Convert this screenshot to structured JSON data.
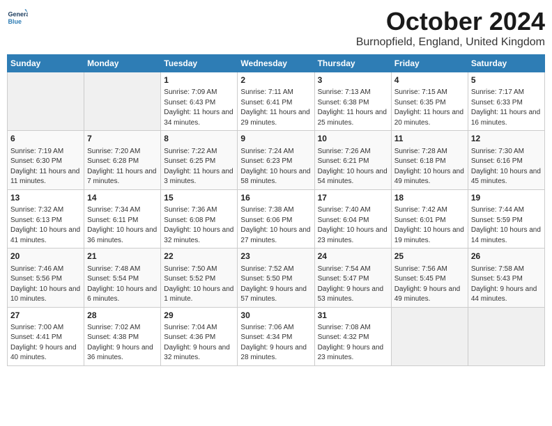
{
  "header": {
    "logo_line1": "General",
    "logo_line2": "Blue",
    "month": "October 2024",
    "location": "Burnopfield, England, United Kingdom"
  },
  "weekdays": [
    "Sunday",
    "Monday",
    "Tuesday",
    "Wednesday",
    "Thursday",
    "Friday",
    "Saturday"
  ],
  "weeks": [
    [
      {
        "day": "",
        "sunrise": "",
        "sunset": "",
        "daylight": ""
      },
      {
        "day": "",
        "sunrise": "",
        "sunset": "",
        "daylight": ""
      },
      {
        "day": "1",
        "sunrise": "Sunrise: 7:09 AM",
        "sunset": "Sunset: 6:43 PM",
        "daylight": "Daylight: 11 hours and 34 minutes."
      },
      {
        "day": "2",
        "sunrise": "Sunrise: 7:11 AM",
        "sunset": "Sunset: 6:41 PM",
        "daylight": "Daylight: 11 hours and 29 minutes."
      },
      {
        "day": "3",
        "sunrise": "Sunrise: 7:13 AM",
        "sunset": "Sunset: 6:38 PM",
        "daylight": "Daylight: 11 hours and 25 minutes."
      },
      {
        "day": "4",
        "sunrise": "Sunrise: 7:15 AM",
        "sunset": "Sunset: 6:35 PM",
        "daylight": "Daylight: 11 hours and 20 minutes."
      },
      {
        "day": "5",
        "sunrise": "Sunrise: 7:17 AM",
        "sunset": "Sunset: 6:33 PM",
        "daylight": "Daylight: 11 hours and 16 minutes."
      }
    ],
    [
      {
        "day": "6",
        "sunrise": "Sunrise: 7:19 AM",
        "sunset": "Sunset: 6:30 PM",
        "daylight": "Daylight: 11 hours and 11 minutes."
      },
      {
        "day": "7",
        "sunrise": "Sunrise: 7:20 AM",
        "sunset": "Sunset: 6:28 PM",
        "daylight": "Daylight: 11 hours and 7 minutes."
      },
      {
        "day": "8",
        "sunrise": "Sunrise: 7:22 AM",
        "sunset": "Sunset: 6:25 PM",
        "daylight": "Daylight: 11 hours and 3 minutes."
      },
      {
        "day": "9",
        "sunrise": "Sunrise: 7:24 AM",
        "sunset": "Sunset: 6:23 PM",
        "daylight": "Daylight: 10 hours and 58 minutes."
      },
      {
        "day": "10",
        "sunrise": "Sunrise: 7:26 AM",
        "sunset": "Sunset: 6:21 PM",
        "daylight": "Daylight: 10 hours and 54 minutes."
      },
      {
        "day": "11",
        "sunrise": "Sunrise: 7:28 AM",
        "sunset": "Sunset: 6:18 PM",
        "daylight": "Daylight: 10 hours and 49 minutes."
      },
      {
        "day": "12",
        "sunrise": "Sunrise: 7:30 AM",
        "sunset": "Sunset: 6:16 PM",
        "daylight": "Daylight: 10 hours and 45 minutes."
      }
    ],
    [
      {
        "day": "13",
        "sunrise": "Sunrise: 7:32 AM",
        "sunset": "Sunset: 6:13 PM",
        "daylight": "Daylight: 10 hours and 41 minutes."
      },
      {
        "day": "14",
        "sunrise": "Sunrise: 7:34 AM",
        "sunset": "Sunset: 6:11 PM",
        "daylight": "Daylight: 10 hours and 36 minutes."
      },
      {
        "day": "15",
        "sunrise": "Sunrise: 7:36 AM",
        "sunset": "Sunset: 6:08 PM",
        "daylight": "Daylight: 10 hours and 32 minutes."
      },
      {
        "day": "16",
        "sunrise": "Sunrise: 7:38 AM",
        "sunset": "Sunset: 6:06 PM",
        "daylight": "Daylight: 10 hours and 27 minutes."
      },
      {
        "day": "17",
        "sunrise": "Sunrise: 7:40 AM",
        "sunset": "Sunset: 6:04 PM",
        "daylight": "Daylight: 10 hours and 23 minutes."
      },
      {
        "day": "18",
        "sunrise": "Sunrise: 7:42 AM",
        "sunset": "Sunset: 6:01 PM",
        "daylight": "Daylight: 10 hours and 19 minutes."
      },
      {
        "day": "19",
        "sunrise": "Sunrise: 7:44 AM",
        "sunset": "Sunset: 5:59 PM",
        "daylight": "Daylight: 10 hours and 14 minutes."
      }
    ],
    [
      {
        "day": "20",
        "sunrise": "Sunrise: 7:46 AM",
        "sunset": "Sunset: 5:56 PM",
        "daylight": "Daylight: 10 hours and 10 minutes."
      },
      {
        "day": "21",
        "sunrise": "Sunrise: 7:48 AM",
        "sunset": "Sunset: 5:54 PM",
        "daylight": "Daylight: 10 hours and 6 minutes."
      },
      {
        "day": "22",
        "sunrise": "Sunrise: 7:50 AM",
        "sunset": "Sunset: 5:52 PM",
        "daylight": "Daylight: 10 hours and 1 minute."
      },
      {
        "day": "23",
        "sunrise": "Sunrise: 7:52 AM",
        "sunset": "Sunset: 5:50 PM",
        "daylight": "Daylight: 9 hours and 57 minutes."
      },
      {
        "day": "24",
        "sunrise": "Sunrise: 7:54 AM",
        "sunset": "Sunset: 5:47 PM",
        "daylight": "Daylight: 9 hours and 53 minutes."
      },
      {
        "day": "25",
        "sunrise": "Sunrise: 7:56 AM",
        "sunset": "Sunset: 5:45 PM",
        "daylight": "Daylight: 9 hours and 49 minutes."
      },
      {
        "day": "26",
        "sunrise": "Sunrise: 7:58 AM",
        "sunset": "Sunset: 5:43 PM",
        "daylight": "Daylight: 9 hours and 44 minutes."
      }
    ],
    [
      {
        "day": "27",
        "sunrise": "Sunrise: 7:00 AM",
        "sunset": "Sunset: 4:41 PM",
        "daylight": "Daylight: 9 hours and 40 minutes."
      },
      {
        "day": "28",
        "sunrise": "Sunrise: 7:02 AM",
        "sunset": "Sunset: 4:38 PM",
        "daylight": "Daylight: 9 hours and 36 minutes."
      },
      {
        "day": "29",
        "sunrise": "Sunrise: 7:04 AM",
        "sunset": "Sunset: 4:36 PM",
        "daylight": "Daylight: 9 hours and 32 minutes."
      },
      {
        "day": "30",
        "sunrise": "Sunrise: 7:06 AM",
        "sunset": "Sunset: 4:34 PM",
        "daylight": "Daylight: 9 hours and 28 minutes."
      },
      {
        "day": "31",
        "sunrise": "Sunrise: 7:08 AM",
        "sunset": "Sunset: 4:32 PM",
        "daylight": "Daylight: 9 hours and 23 minutes."
      },
      {
        "day": "",
        "sunrise": "",
        "sunset": "",
        "daylight": ""
      },
      {
        "day": "",
        "sunrise": "",
        "sunset": "",
        "daylight": ""
      }
    ]
  ]
}
